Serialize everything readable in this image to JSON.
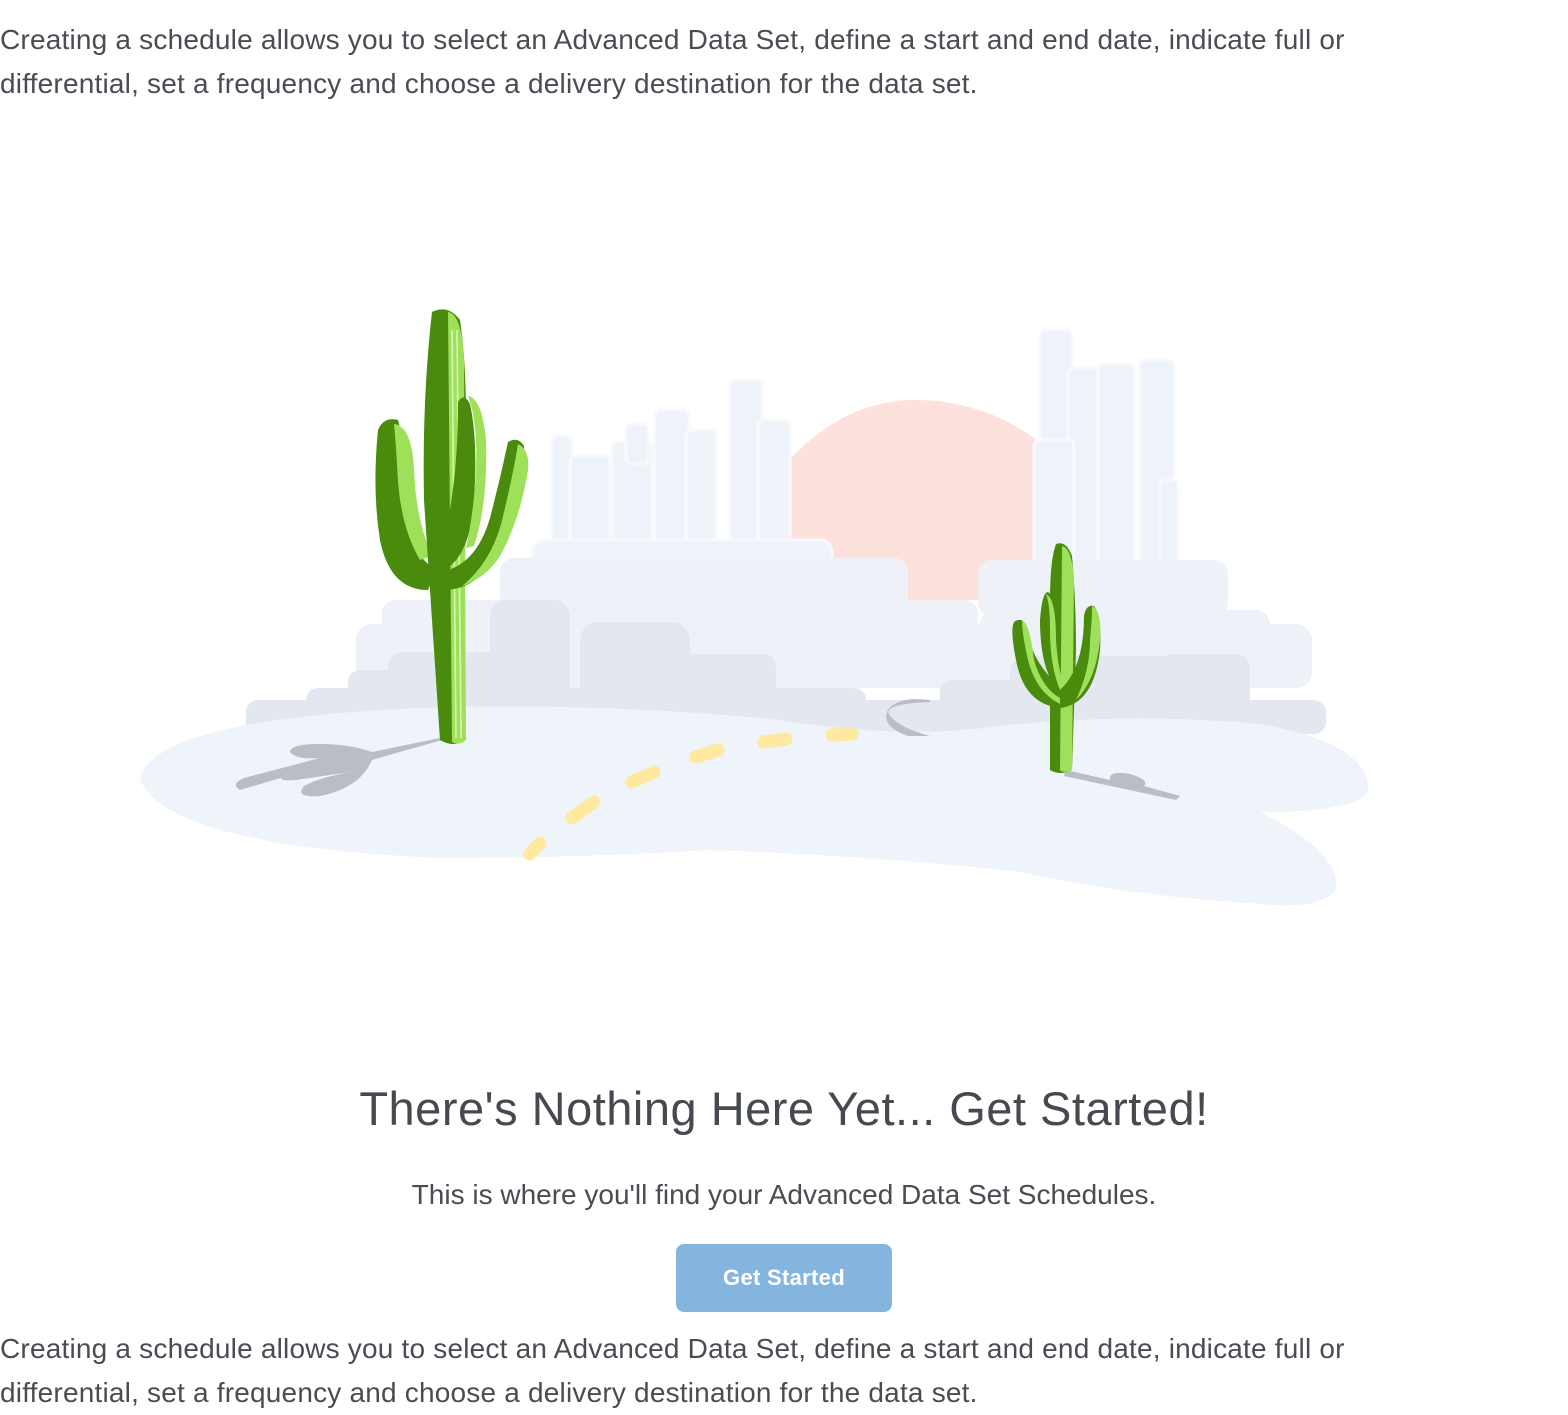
{
  "intro": {
    "text": "Creating a schedule allows you to select an Advanced Data Set, define a start and end date, indicate full or differential, set a frequency and choose a delivery destination for the data set."
  },
  "empty_state": {
    "illustration": "desert-cactus-illustration",
    "headline": "There's Nothing Here Yet... Get Started!",
    "subline": "This is where you'll find your Advanced Data Set Schedules.",
    "cta_label": "Get Started"
  },
  "footer_intro": {
    "text": "Creating a schedule allows you to select an Advanced Data Set, define a start and end date, indicate full or differential, set a frequency and choose a delivery destination for the data set."
  },
  "colors": {
    "text": "#494c52",
    "cta_background": "#84b5de",
    "cta_text": "#ffffff",
    "cactus_dark": "#4a8a0c",
    "cactus_light": "#9ee05a",
    "sun": "#fde1dc",
    "ground": "#eff3fa",
    "road_dash": "#ffe9a0"
  }
}
